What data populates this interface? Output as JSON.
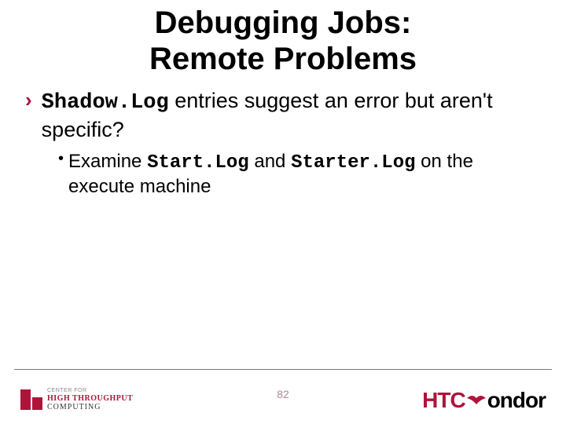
{
  "title_line1": "Debugging Jobs:",
  "title_line2": "Remote Problems",
  "bullet1": {
    "marker": "›",
    "code1": "Shadow.Log",
    "text_after1": " entries suggest an error but aren't specific?"
  },
  "bullet2": {
    "marker": "•",
    "text_before": "Examine ",
    "code1": "Start.Log",
    "text_mid": " and ",
    "code2": "Starter.Log",
    "text_after": " on the execute machine"
  },
  "page_number": "82",
  "logo_left": {
    "line1": "CENTER FOR",
    "line2": "HIGH THROUGHPUT",
    "line3": "COMPUTING"
  },
  "logo_right": {
    "part1": "HTC",
    "part2": "ondor"
  }
}
